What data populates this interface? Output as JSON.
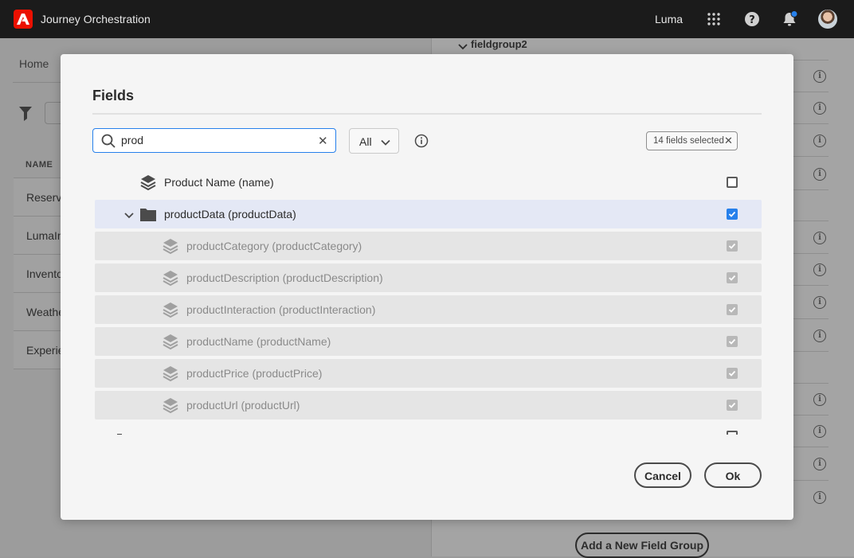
{
  "app": {
    "title": "Journey Orchestration",
    "org": "Luma",
    "brand_color": "#eb1000",
    "icons": [
      "adobe-logo",
      "apps-grid-icon",
      "help-icon",
      "bell-icon",
      "avatar"
    ]
  },
  "background": {
    "breadcrumb": "Home",
    "column_header": "NAME",
    "rows": [
      "Reserva",
      "LumaIn",
      "Invento",
      "Weathe",
      "Experie"
    ],
    "right_group": "fieldgroup2",
    "add_button": "Add a New Field Group"
  },
  "modal": {
    "title": "Fields",
    "search": {
      "value": "prod",
      "placeholder": ""
    },
    "filter": {
      "selected": "All"
    },
    "selected_badge": "14 fields selected",
    "accent": "#2680eb",
    "rows": [
      {
        "label": "Product Name (name)",
        "icon": "layers-icon",
        "checked": false,
        "disabled": false
      },
      {
        "label": "productData (productData)",
        "icon": "folder-icon",
        "checked": true,
        "disabled": false,
        "expanded": true
      },
      {
        "label": "productCategory (productCategory)",
        "icon": "layers-icon",
        "checked": true,
        "disabled": true
      },
      {
        "label": "productDescription (productDescription)",
        "icon": "layers-icon",
        "checked": true,
        "disabled": true
      },
      {
        "label": "productInteraction (productInteraction)",
        "icon": "layers-icon",
        "checked": true,
        "disabled": true
      },
      {
        "label": "productName (productName)",
        "icon": "layers-icon",
        "checked": true,
        "disabled": true
      },
      {
        "label": "productPrice (productPrice)",
        "icon": "layers-icon",
        "checked": true,
        "disabled": true
      },
      {
        "label": "productUrl (productUrl)",
        "icon": "layers-icon",
        "checked": true,
        "disabled": true
      }
    ],
    "cancel_label": "Cancel",
    "ok_label": "Ok"
  }
}
